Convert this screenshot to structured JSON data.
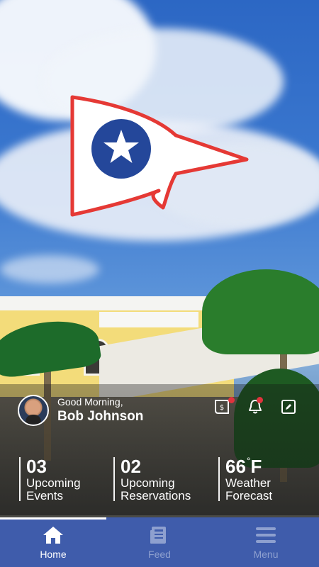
{
  "greeting": {
    "salutation": "Good Morning,",
    "name": "Bob Johnson"
  },
  "header_icons": [
    {
      "name": "statement-icon",
      "badge": true
    },
    {
      "name": "notification-bell-icon",
      "badge": true
    },
    {
      "name": "edit-icon",
      "badge": false
    }
  ],
  "stats": [
    {
      "value": "03",
      "label_line1": "Upcoming",
      "label_line2": "Events"
    },
    {
      "value": "02",
      "label_line1": "Upcoming",
      "label_line2": "Reservations"
    },
    {
      "value": "66",
      "unit": "F",
      "degree": "°",
      "label_line1": "Weather",
      "label_line2": "Forecast"
    }
  ],
  "nav": {
    "items": [
      {
        "label": "Home",
        "icon": "home-icon",
        "active": true
      },
      {
        "label": "Feed",
        "icon": "feed-icon",
        "active": false
      },
      {
        "label": "Menu",
        "icon": "menu-icon",
        "active": false
      }
    ]
  },
  "colors": {
    "nav_background": "#3f5cab",
    "nav_inactive": "#8ea0cf",
    "badge_red": "#e1333d",
    "burgee_red": "#e53935",
    "burgee_blue": "#24479a"
  }
}
